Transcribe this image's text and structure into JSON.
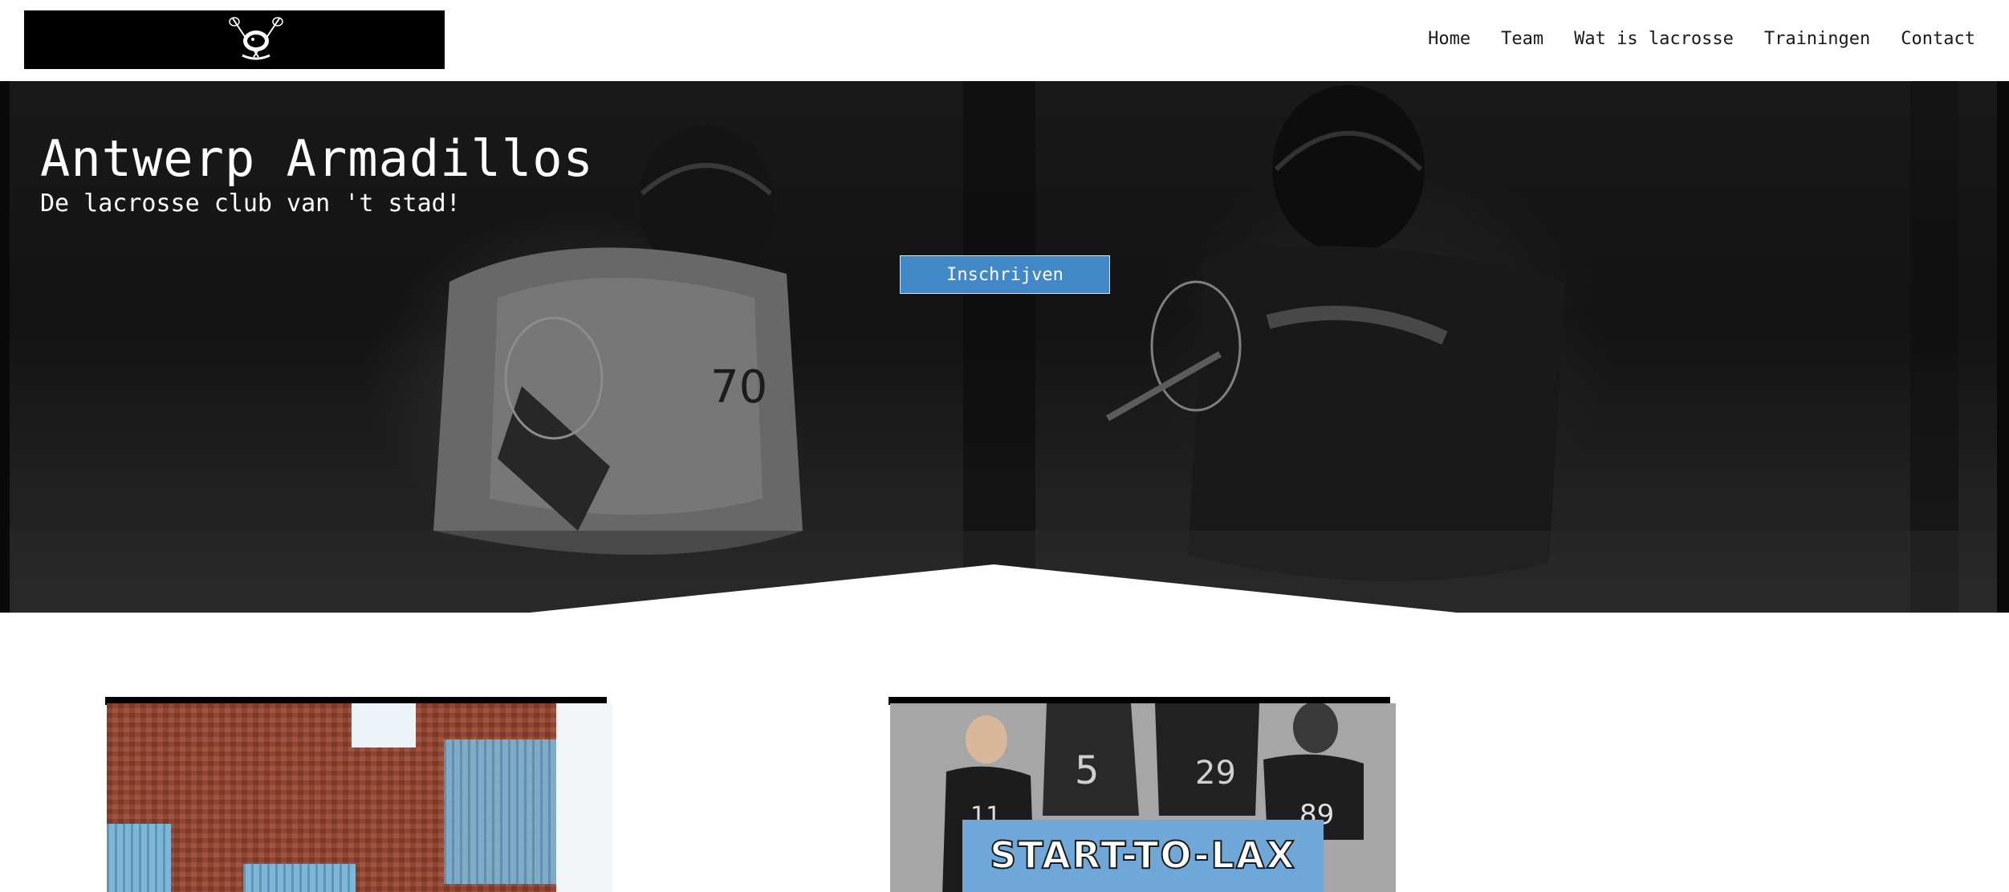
{
  "header": {
    "logo_alt": "Antwerp Armadillos logo",
    "nav": [
      "Home",
      "Team",
      "Wat is lacrosse",
      "Trainingen",
      "Contact"
    ]
  },
  "hero": {
    "title": "Antwerp Armadillos",
    "subtitle": "De lacrosse club van 't stad!",
    "cta_label": "Inschrijven",
    "jersey_number": "70"
  },
  "cards": [
    {
      "name": "museum-photo"
    },
    {
      "name": "start-to-lax-promo",
      "banner_text": "START-TO-LAX",
      "jersey_numbers": [
        "11",
        "5",
        "29",
        "89"
      ]
    }
  ],
  "colors": {
    "accent": "#4189c6",
    "header_bg": "#ffffff",
    "logo_bg": "#000000",
    "hero_overlay": "#262626",
    "brick": "#8e4632",
    "banner": "#6fa8d8"
  }
}
